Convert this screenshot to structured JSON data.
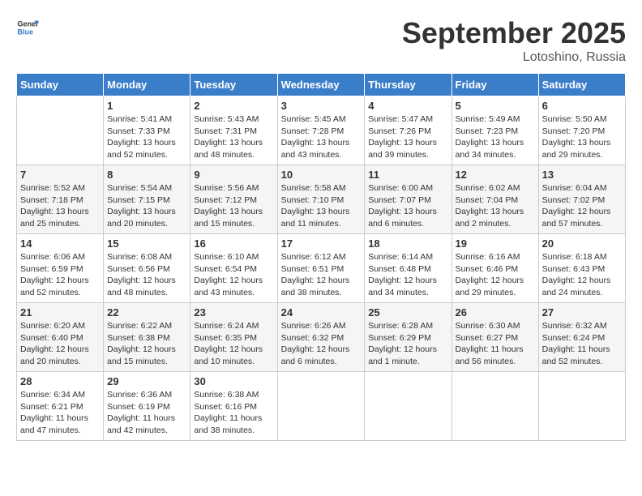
{
  "app": {
    "logo_general": "General",
    "logo_blue": "Blue"
  },
  "header": {
    "month_year": "September 2025",
    "location": "Lotoshino, Russia"
  },
  "weekdays": [
    "Sunday",
    "Monday",
    "Tuesday",
    "Wednesday",
    "Thursday",
    "Friday",
    "Saturday"
  ],
  "weeks": [
    [
      {
        "day": "",
        "info": ""
      },
      {
        "day": "1",
        "info": "Sunrise: 5:41 AM\nSunset: 7:33 PM\nDaylight: 13 hours\nand 52 minutes."
      },
      {
        "day": "2",
        "info": "Sunrise: 5:43 AM\nSunset: 7:31 PM\nDaylight: 13 hours\nand 48 minutes."
      },
      {
        "day": "3",
        "info": "Sunrise: 5:45 AM\nSunset: 7:28 PM\nDaylight: 13 hours\nand 43 minutes."
      },
      {
        "day": "4",
        "info": "Sunrise: 5:47 AM\nSunset: 7:26 PM\nDaylight: 13 hours\nand 39 minutes."
      },
      {
        "day": "5",
        "info": "Sunrise: 5:49 AM\nSunset: 7:23 PM\nDaylight: 13 hours\nand 34 minutes."
      },
      {
        "day": "6",
        "info": "Sunrise: 5:50 AM\nSunset: 7:20 PM\nDaylight: 13 hours\nand 29 minutes."
      }
    ],
    [
      {
        "day": "7",
        "info": "Sunrise: 5:52 AM\nSunset: 7:18 PM\nDaylight: 13 hours\nand 25 minutes."
      },
      {
        "day": "8",
        "info": "Sunrise: 5:54 AM\nSunset: 7:15 PM\nDaylight: 13 hours\nand 20 minutes."
      },
      {
        "day": "9",
        "info": "Sunrise: 5:56 AM\nSunset: 7:12 PM\nDaylight: 13 hours\nand 15 minutes."
      },
      {
        "day": "10",
        "info": "Sunrise: 5:58 AM\nSunset: 7:10 PM\nDaylight: 13 hours\nand 11 minutes."
      },
      {
        "day": "11",
        "info": "Sunrise: 6:00 AM\nSunset: 7:07 PM\nDaylight: 13 hours\nand 6 minutes."
      },
      {
        "day": "12",
        "info": "Sunrise: 6:02 AM\nSunset: 7:04 PM\nDaylight: 13 hours\nand 2 minutes."
      },
      {
        "day": "13",
        "info": "Sunrise: 6:04 AM\nSunset: 7:02 PM\nDaylight: 12 hours\nand 57 minutes."
      }
    ],
    [
      {
        "day": "14",
        "info": "Sunrise: 6:06 AM\nSunset: 6:59 PM\nDaylight: 12 hours\nand 52 minutes."
      },
      {
        "day": "15",
        "info": "Sunrise: 6:08 AM\nSunset: 6:56 PM\nDaylight: 12 hours\nand 48 minutes."
      },
      {
        "day": "16",
        "info": "Sunrise: 6:10 AM\nSunset: 6:54 PM\nDaylight: 12 hours\nand 43 minutes."
      },
      {
        "day": "17",
        "info": "Sunrise: 6:12 AM\nSunset: 6:51 PM\nDaylight: 12 hours\nand 38 minutes."
      },
      {
        "day": "18",
        "info": "Sunrise: 6:14 AM\nSunset: 6:48 PM\nDaylight: 12 hours\nand 34 minutes."
      },
      {
        "day": "19",
        "info": "Sunrise: 6:16 AM\nSunset: 6:46 PM\nDaylight: 12 hours\nand 29 minutes."
      },
      {
        "day": "20",
        "info": "Sunrise: 6:18 AM\nSunset: 6:43 PM\nDaylight: 12 hours\nand 24 minutes."
      }
    ],
    [
      {
        "day": "21",
        "info": "Sunrise: 6:20 AM\nSunset: 6:40 PM\nDaylight: 12 hours\nand 20 minutes."
      },
      {
        "day": "22",
        "info": "Sunrise: 6:22 AM\nSunset: 6:38 PM\nDaylight: 12 hours\nand 15 minutes."
      },
      {
        "day": "23",
        "info": "Sunrise: 6:24 AM\nSunset: 6:35 PM\nDaylight: 12 hours\nand 10 minutes."
      },
      {
        "day": "24",
        "info": "Sunrise: 6:26 AM\nSunset: 6:32 PM\nDaylight: 12 hours\nand 6 minutes."
      },
      {
        "day": "25",
        "info": "Sunrise: 6:28 AM\nSunset: 6:29 PM\nDaylight: 12 hours\nand 1 minute."
      },
      {
        "day": "26",
        "info": "Sunrise: 6:30 AM\nSunset: 6:27 PM\nDaylight: 11 hours\nand 56 minutes."
      },
      {
        "day": "27",
        "info": "Sunrise: 6:32 AM\nSunset: 6:24 PM\nDaylight: 11 hours\nand 52 minutes."
      }
    ],
    [
      {
        "day": "28",
        "info": "Sunrise: 6:34 AM\nSunset: 6:21 PM\nDaylight: 11 hours\nand 47 minutes."
      },
      {
        "day": "29",
        "info": "Sunrise: 6:36 AM\nSunset: 6:19 PM\nDaylight: 11 hours\nand 42 minutes."
      },
      {
        "day": "30",
        "info": "Sunrise: 6:38 AM\nSunset: 6:16 PM\nDaylight: 11 hours\nand 38 minutes."
      },
      {
        "day": "",
        "info": ""
      },
      {
        "day": "",
        "info": ""
      },
      {
        "day": "",
        "info": ""
      },
      {
        "day": "",
        "info": ""
      }
    ]
  ]
}
